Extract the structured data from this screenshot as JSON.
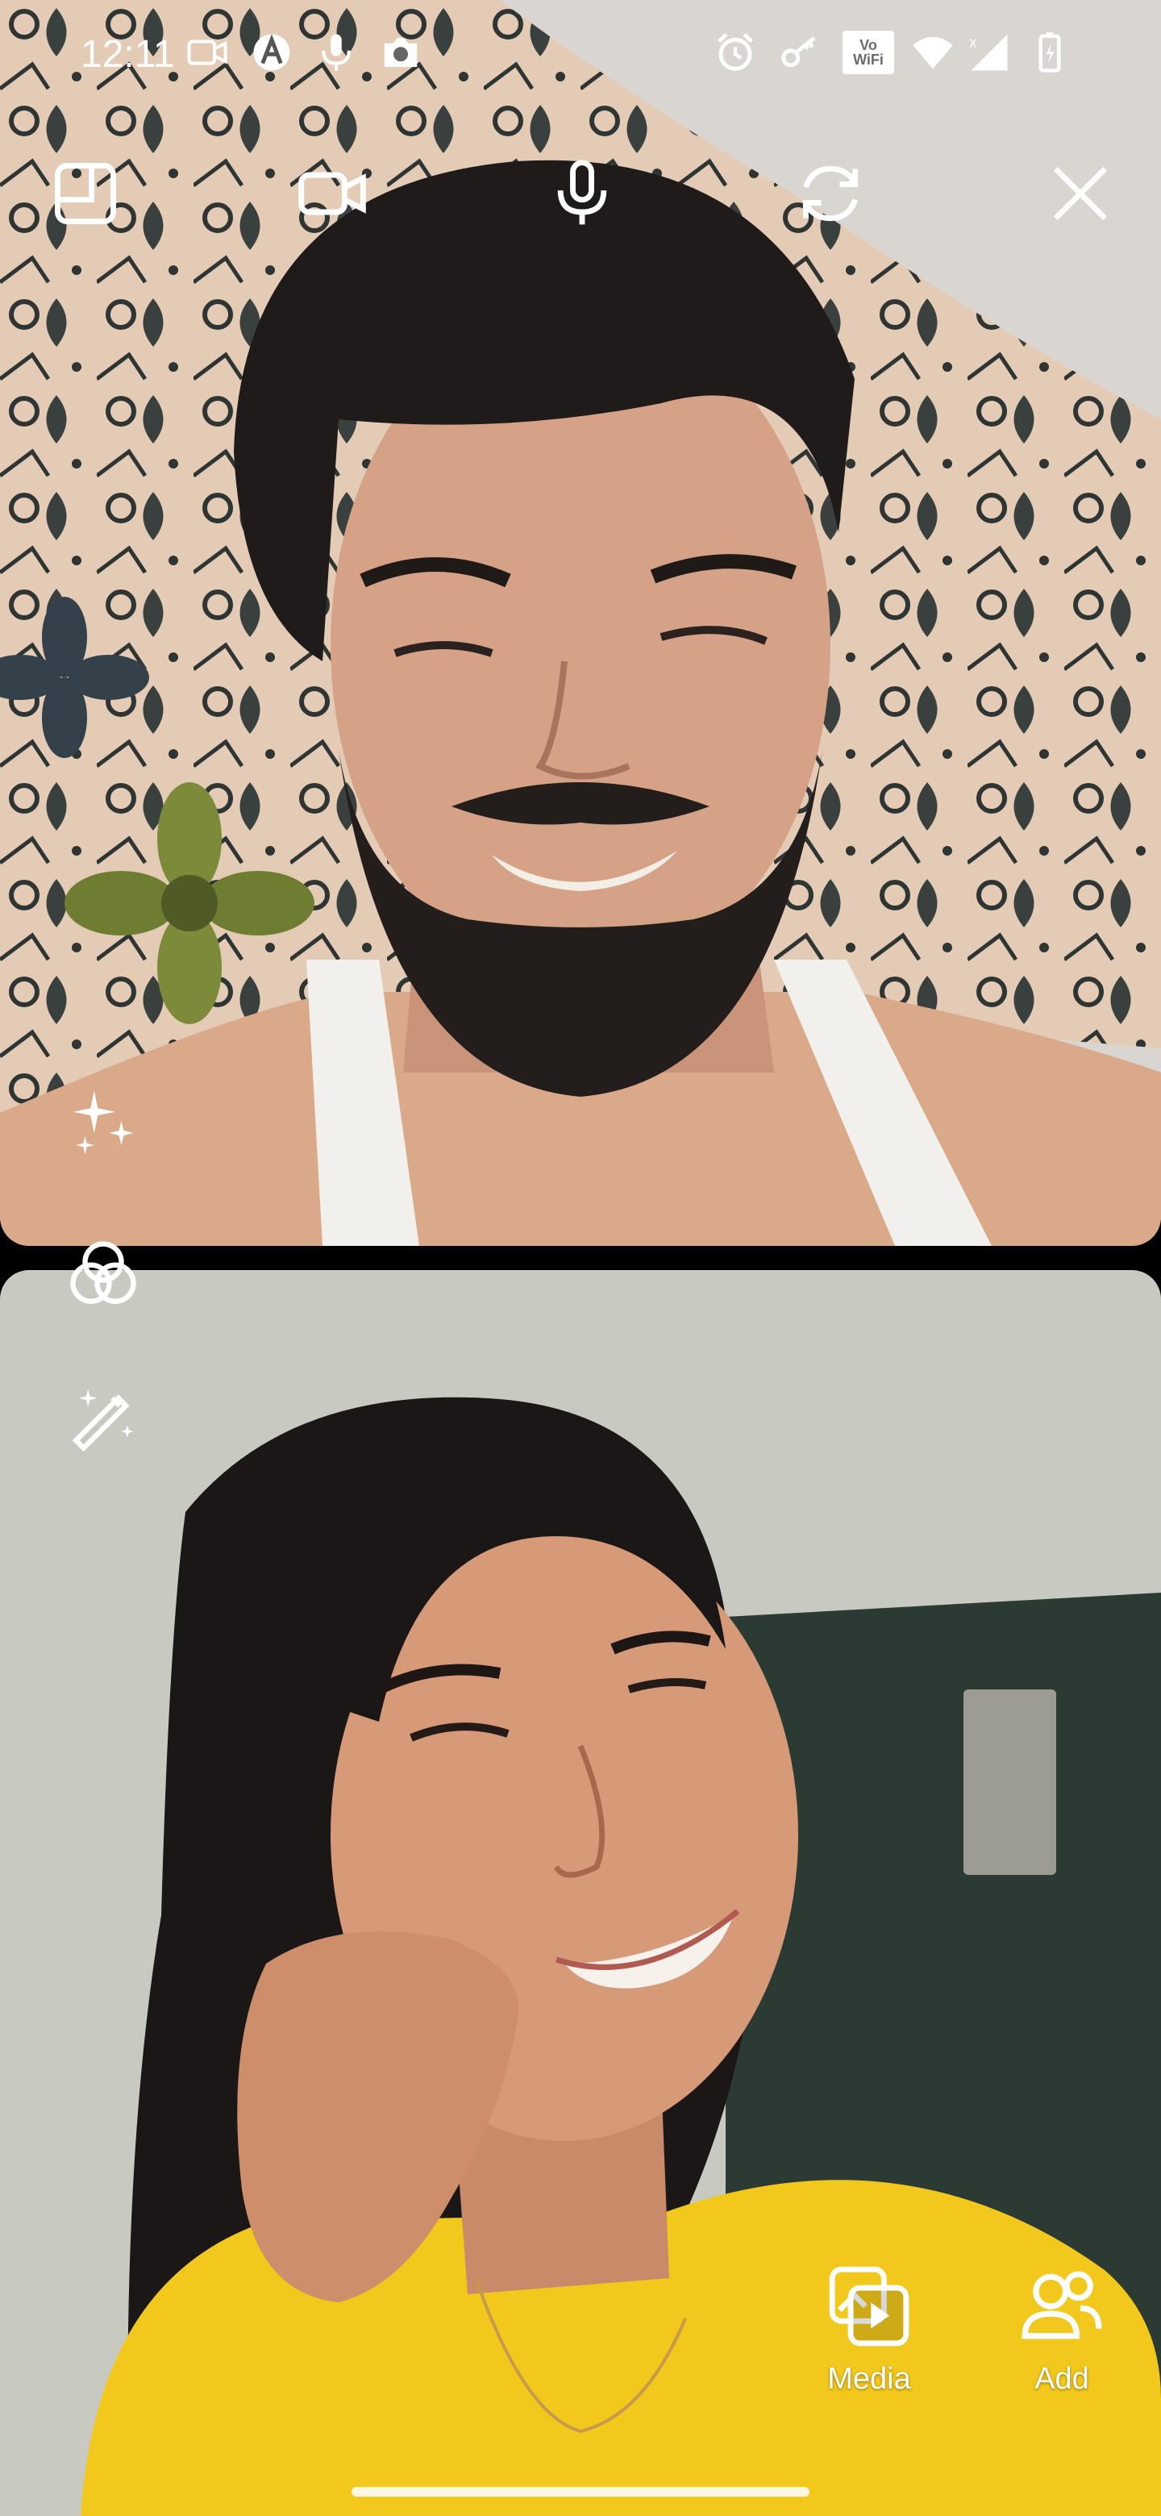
{
  "status_bar": {
    "time": "12:11",
    "left_icons": [
      "video-camera-icon",
      "a-logo-icon",
      "microphone-icon",
      "camera-icon"
    ],
    "right_icons": [
      "alarm-icon",
      "key-icon",
      "vowifi-icon",
      "wifi-icon",
      "signal-icon",
      "battery-icon"
    ],
    "vowifi_line1": "Vo",
    "vowifi_line2": "WiFi"
  },
  "call_controls": [
    {
      "name": "layout-icon",
      "label": "Layout"
    },
    {
      "name": "video-camera-icon",
      "label": "Camera"
    },
    {
      "name": "microphone-icon",
      "label": "Microphone"
    },
    {
      "name": "flip-camera-icon",
      "label": "Flip camera"
    },
    {
      "name": "close-icon",
      "label": "End call"
    }
  ],
  "effects": [
    {
      "name": "sparkles-icon"
    },
    {
      "name": "color-filter-icon"
    },
    {
      "name": "magic-wand-icon"
    }
  ],
  "actions": {
    "media_label": "Media",
    "add_label": "Add"
  },
  "colors": {
    "icon": "#ffffff",
    "background": "#000000",
    "wall_top": "#d7d4ce",
    "wall_bottom": "#c9cbc3",
    "shirt": "#f2c81c"
  }
}
